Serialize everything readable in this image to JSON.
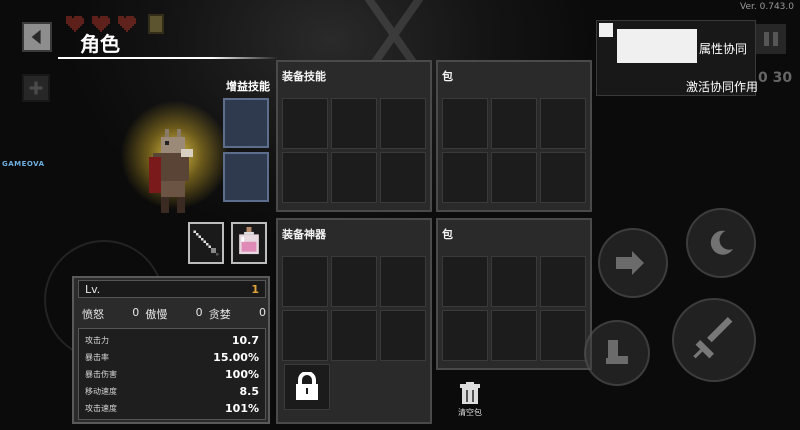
{
  "version": "Ver. 0.743.0",
  "header": {
    "title": "角色"
  },
  "equipped_skills_label": "增益技能",
  "panels": {
    "equip_skills": {
      "title": "装备技能"
    },
    "bag_top": {
      "title": "包"
    },
    "equip_artifacts": {
      "title": "装备神器"
    },
    "bag_bottom": {
      "title": "包"
    }
  },
  "stats": {
    "level_label": "Lv.",
    "level_value": "1",
    "traits": [
      {
        "name": "愤怒",
        "value": "0"
      },
      {
        "name": "傲慢",
        "value": "0"
      },
      {
        "name": "贪婪",
        "value": "0"
      }
    ],
    "rows": [
      {
        "name": "攻击力",
        "value": "10.7"
      },
      {
        "name": "暴击率",
        "value": "15.00%"
      },
      {
        "name": "暴击伤害",
        "value": "100%"
      },
      {
        "name": "移动速度",
        "value": "8.5"
      },
      {
        "name": "攻击速度",
        "value": "101%"
      }
    ]
  },
  "trash": {
    "label": "清空包"
  },
  "hud": {
    "synergy": "属性协同",
    "synergy_active": "激活协同作用",
    "timer": "0 30",
    "watermark": "GAMEOVA"
  },
  "colors": {
    "accent_gold": "#e0a53a",
    "skill_slot": "#2f3a4f",
    "panel_bg": "#2a2a2a"
  }
}
